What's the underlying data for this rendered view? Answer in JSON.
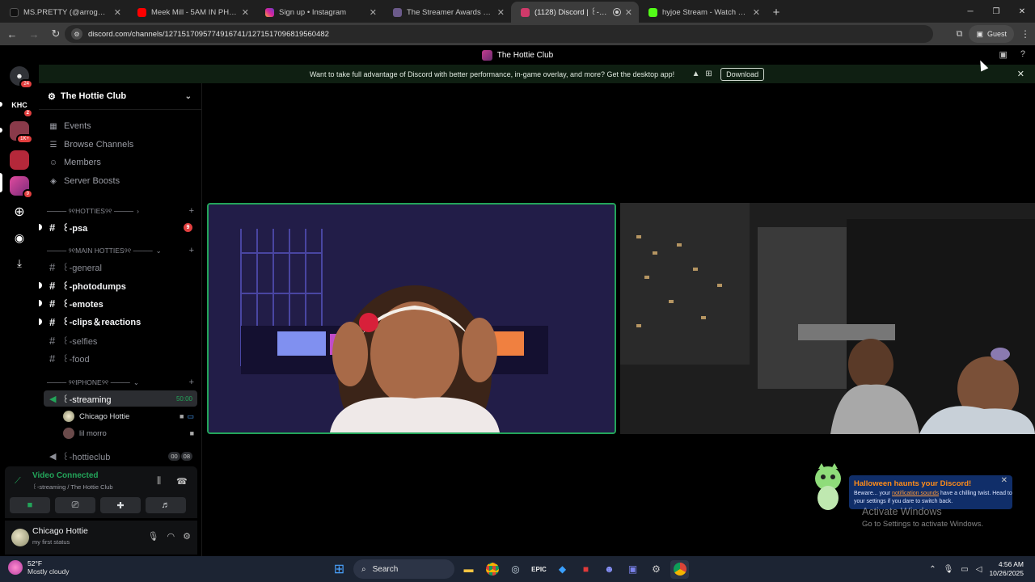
{
  "browser": {
    "tabs": [
      {
        "title": "MS.PRETTY (@arrogantdoll) | TikTok",
        "color": "#111111"
      },
      {
        "title": "Meek Mill - 5AM IN PHILLY (Official Video)",
        "color": "#ff0000"
      },
      {
        "title": "Sign up • Instagram",
        "color": "#d6249f"
      },
      {
        "title": "The Streamer Awards - Nominations",
        "color": "#6b5a8a"
      },
      {
        "title": "(1128) Discord | ꒰-streaming",
        "color": "#d03a6a"
      },
      {
        "title": "hyjoe Stream - Watch Live on Kick",
        "color": "#53fc18"
      }
    ],
    "url": "discord.com/channels/1271517095774916741/1271517096819560482",
    "profile": "Guest"
  },
  "discord": {
    "server_name": "The Hottie Club",
    "banner": {
      "text": "Want to take full advantage of Discord with better performance, in-game overlay, and more? Get the desktop app!",
      "button": "Download"
    },
    "guilds": [
      {
        "label": "",
        "badge": "24",
        "color": "#5865f2"
      },
      {
        "label": "KHC",
        "badge": "2",
        "color": "#000000"
      },
      {
        "label": "",
        "badge": "1K+",
        "color": "#8a3a4a"
      },
      {
        "label": "",
        "badge": "",
        "color": "#b4283a"
      },
      {
        "label": "",
        "badge": "9",
        "color": "#c73b9a"
      }
    ],
    "nav": [
      {
        "label": "Events",
        "icon": "calendar-icon"
      },
      {
        "label": "Browse Channels",
        "icon": "browse-icon"
      },
      {
        "label": "Members",
        "icon": "members-icon"
      },
      {
        "label": "Server Boosts",
        "icon": "boost-icon"
      }
    ],
    "categories": {
      "hotties": "──── ୨୧HOTTIES୨୧ ────",
      "main": "──── ୨୧MAIN HOTTIES୨୧ ────",
      "iphone": "──── ୨୧IPHONE୨୧ ────"
    },
    "channels": {
      "psa": {
        "label": "꒰-psa",
        "badge": "9"
      },
      "general": {
        "label": "꒰-general"
      },
      "photodumps": {
        "label": "꒰-photodumps"
      },
      "emotes": {
        "label": "꒰-emotes"
      },
      "clips": {
        "label": "꒰-clips＆reactions"
      },
      "selfies": {
        "label": "꒰-selfies"
      },
      "food": {
        "label": "꒰-food"
      },
      "streaming": {
        "label": "꒰-streaming",
        "timer": "50:00"
      },
      "hottieclub": {
        "label": "꒰-hottieclub",
        "count_a": "00",
        "count_b": "08"
      }
    },
    "voice_users": [
      {
        "name": "Chicago Hottie"
      },
      {
        "name": "lil morro"
      }
    ],
    "voice_panel": {
      "status": "Video Connected",
      "location": "꒰-streaming / The Hottie Club"
    },
    "user": {
      "name": "Chicago Hottie",
      "status": "my first status"
    },
    "toast": {
      "title": "Halloween haunts your Discord!",
      "body_prefix": "Beware... your",
      "link": "notification sounds",
      "body_suffix": "have a chilling twist. Head to your settings if you dare to switch back."
    }
  },
  "windows": {
    "activate_title": "Activate Windows",
    "activate_sub": "Go to Settings to activate Windows.",
    "weather_temp": "52°F",
    "weather_desc": "Mostly cloudy",
    "search_placeholder": "Search",
    "time": "4:56 AM",
    "date": "10/26/2025"
  }
}
